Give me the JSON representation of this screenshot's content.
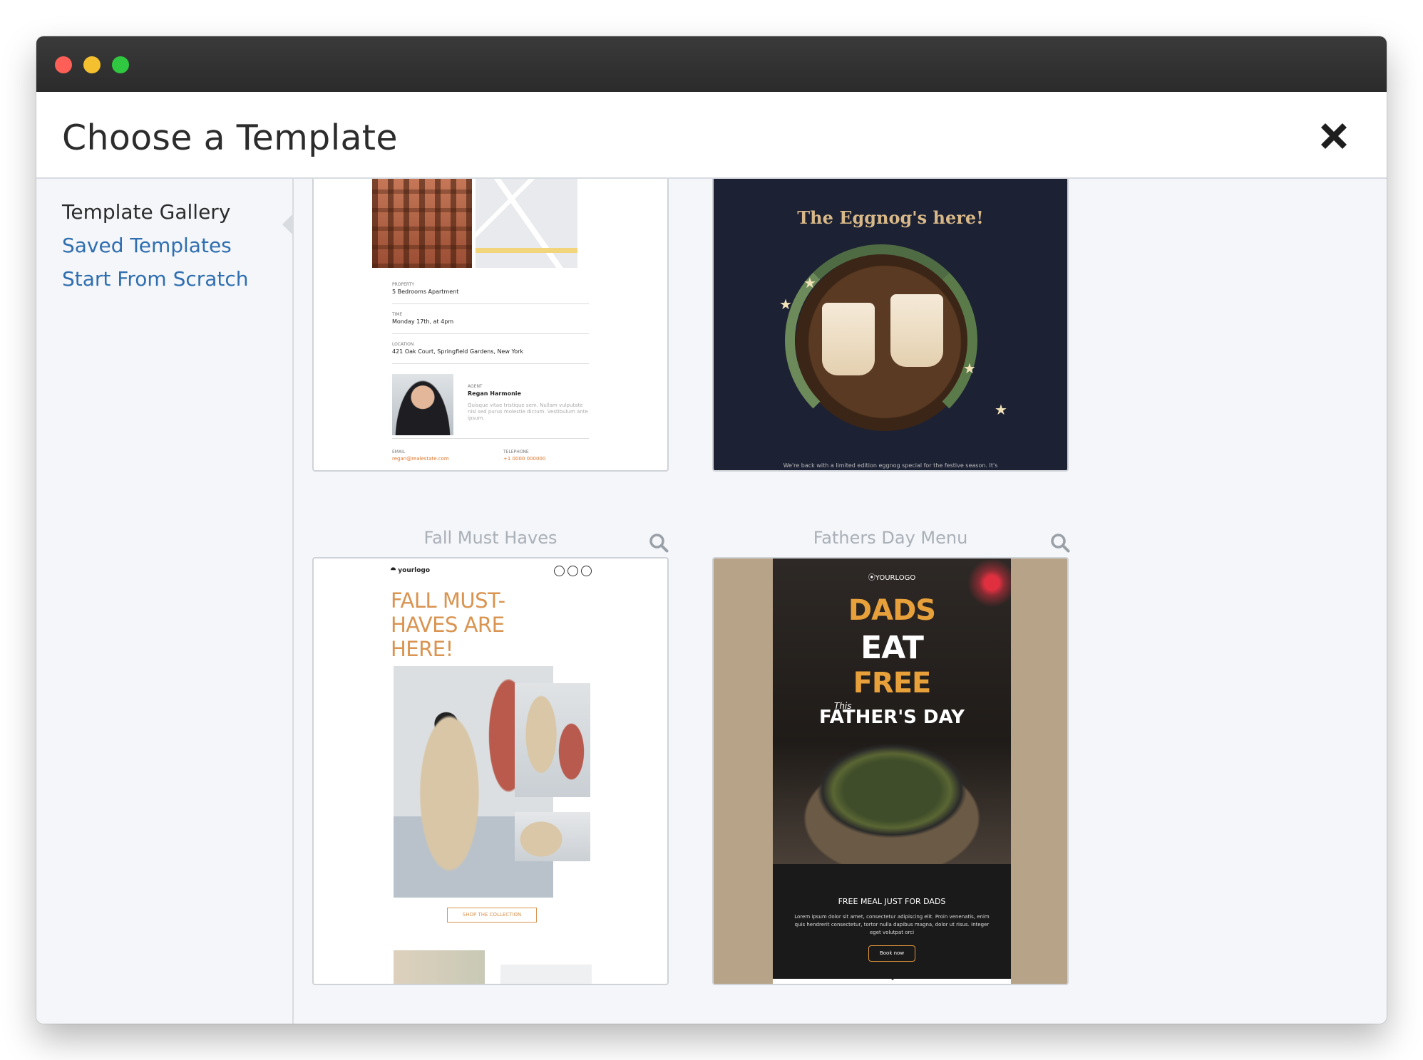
{
  "window": {
    "title": "Choose a Template"
  },
  "sidebar": {
    "items": [
      {
        "label": "Template Gallery",
        "active": true
      },
      {
        "label": "Saved Templates",
        "active": false
      },
      {
        "label": "Start From Scratch",
        "active": false
      }
    ]
  },
  "templates": [
    {
      "name": "",
      "preview": {
        "property_label": "PROPERTY",
        "property_value": "5 Bedrooms Apartment",
        "time_label": "TIME",
        "time_value": "Monday 17th, at 4pm",
        "location_label": "LOCATION",
        "location_value": "421 Oak Court, Springfield Gardens, New York",
        "agent_label": "AGENT",
        "agent_name": "Regan Harmonie",
        "agent_bio": "Quisque vitae tristique sem. Nullam vulputate nisl sed purus molestie dictum. Vestibulum ante ipsum.",
        "email_label": "EMAIL",
        "email_value": "regan@realestate.com",
        "phone_label": "TELEPHONE",
        "phone_value": "+1 0000 000000"
      }
    },
    {
      "name": "",
      "preview": {
        "headline": "The Eggnog's here!",
        "footer": "We're back with a limited edition eggnog special for the festive season. It's"
      }
    },
    {
      "name": "Fall Must Haves",
      "preview": {
        "logo": "yourlogo",
        "headline": "FALL MUST-HAVES ARE HERE!",
        "cta": "SHOP THE COLLECTION"
      }
    },
    {
      "name": "Fathers Day Menu",
      "preview": {
        "logo": "⦿YOURLOGO",
        "line1": "DADS",
        "line2": "EAT",
        "line3": "FREE",
        "this": "This",
        "occasion": "FATHER'S DAY",
        "heading": "FREE MEAL JUST FOR DADS",
        "body": "Lorem ipsum dolor sit amet, consectetur adipiscing elit. Proin venenatis, enim quis hendrerit consectetur, tortor nulla dapibus magna, dolor ut risus. Integer eget volutpat orci",
        "cta": "Book now"
      }
    }
  ],
  "colors": {
    "link": "#2f6eb0",
    "accent_fall": "#d99451",
    "accent_dads": "#e8a03a"
  },
  "icons": [
    "close-icon",
    "search-icon"
  ]
}
